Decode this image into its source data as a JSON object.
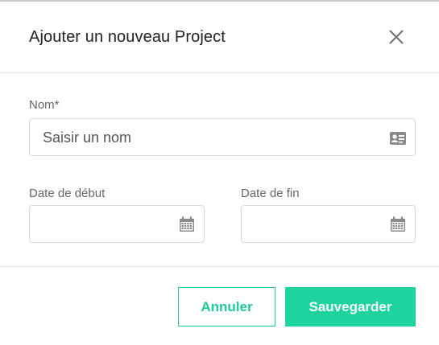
{
  "dialog": {
    "title": "Ajouter un nouveau Project",
    "close_icon": "close-icon"
  },
  "form": {
    "name": {
      "label": "Nom*",
      "placeholder": "Saisir un nom",
      "icon": "id-card-icon"
    },
    "start_date": {
      "label": "Date de début",
      "value": "",
      "icon": "calendar-icon"
    },
    "end_date": {
      "label": "Date de fin",
      "value": "",
      "icon": "calendar-icon"
    }
  },
  "actions": {
    "cancel_label": "Annuler",
    "save_label": "Sauvegarder"
  },
  "colors": {
    "accent": "#1fd39f",
    "border": "#dadada",
    "text": "#222222"
  }
}
